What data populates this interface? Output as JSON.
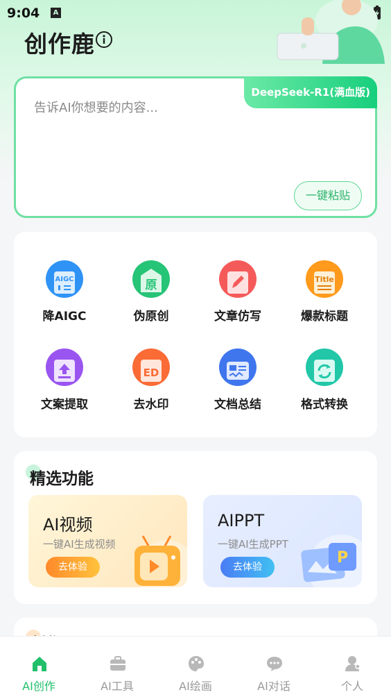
{
  "status_bar": {
    "time": "9:04",
    "notif_glyph": "A"
  },
  "header": {
    "app_title": "创作鹿"
  },
  "input": {
    "placeholder": "告诉AI你想要的内容...",
    "model_badge": "DeepSeek-R1(满血版)",
    "paste_label": "一键粘贴"
  },
  "tools": [
    {
      "label": "降AIGC",
      "icon": "aigc-icon",
      "color": "#2f93f5",
      "glyph": "AIGC"
    },
    {
      "label": "伪原创",
      "icon": "original-icon",
      "color": "#25c476",
      "glyph": "原"
    },
    {
      "label": "文章仿写",
      "icon": "pencil-edit-icon",
      "color": "#f55a5a",
      "glyph": "✎"
    },
    {
      "label": "爆款标题",
      "icon": "title-icon",
      "color": "#ff9a1c",
      "glyph": "Title"
    },
    {
      "label": "文案提取",
      "icon": "upload-extract-icon",
      "color": "#9a55f0",
      "glyph": "⤒"
    },
    {
      "label": "去水印",
      "icon": "watermark-icon",
      "color": "#fa6b36",
      "glyph": "ED"
    },
    {
      "label": "文档总结",
      "icon": "document-summary-icon",
      "color": "#3f76ee",
      "glyph": "≡"
    },
    {
      "label": "格式转换",
      "icon": "convert-icon",
      "color": "#22c7a8",
      "glyph": "⟳"
    }
  ],
  "featured": {
    "title": "精选功能",
    "video": {
      "title": "AI视频",
      "subtitle": "一键AI生成视频",
      "button": "去体验"
    },
    "ppt": {
      "title": "AIPPT",
      "subtitle": "一键AI生成PPT",
      "button": "去体验"
    }
  },
  "creation_tools": {
    "title": "创作工具"
  },
  "tabs": [
    {
      "label": "AI创作",
      "icon": "home-icon",
      "active": true
    },
    {
      "label": "AI工具",
      "icon": "toolbox-icon",
      "active": false
    },
    {
      "label": "AI绘画",
      "icon": "palette-icon",
      "active": false
    },
    {
      "label": "AI对话",
      "icon": "chat-icon",
      "active": false
    },
    {
      "label": "个人",
      "icon": "person-icon",
      "active": false
    }
  ],
  "colors": {
    "accent": "#22c06b",
    "accent_light": "#6fe0a3"
  }
}
